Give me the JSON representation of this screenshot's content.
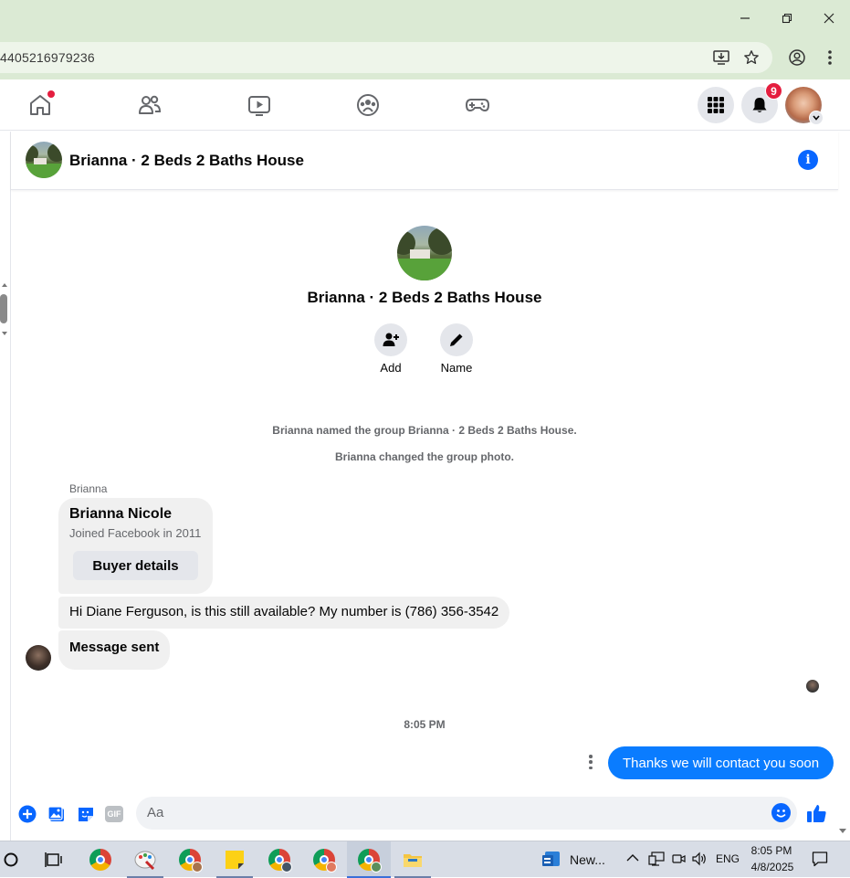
{
  "browser": {
    "url": "4405216979236",
    "window_buttons": {
      "minimize": "—",
      "restore": "❐",
      "close": "✕"
    }
  },
  "fb_nav": {
    "notification_count": "9"
  },
  "conversation": {
    "header_title": "Brianna · 2 Beds 2 Baths House",
    "group_title": "Brianna · 2 Beds 2 Baths House",
    "actions": [
      {
        "label": "Add"
      },
      {
        "label": "Name"
      }
    ],
    "system_messages": [
      "Brianna named the group Brianna · 2 Beds 2 Baths House.",
      "Brianna changed the group photo."
    ],
    "sender_name": "Brianna",
    "profile_card": {
      "name": "Brianna Nicole",
      "subtitle": "Joined Facebook in 2011",
      "button": "Buyer details"
    },
    "incoming_messages": [
      "Hi Diane Ferguson, is this still available? My number is (786) 356-3542",
      "Message sent"
    ],
    "timestamp": "8:05 PM",
    "outgoing_message": "Thanks we will contact you soon"
  },
  "composer": {
    "placeholder": "Aa",
    "gif_label": "GIF"
  },
  "taskbar": {
    "news_label": "New...",
    "language": "ENG",
    "time": "8:05 PM",
    "date": "4/8/2025"
  }
}
